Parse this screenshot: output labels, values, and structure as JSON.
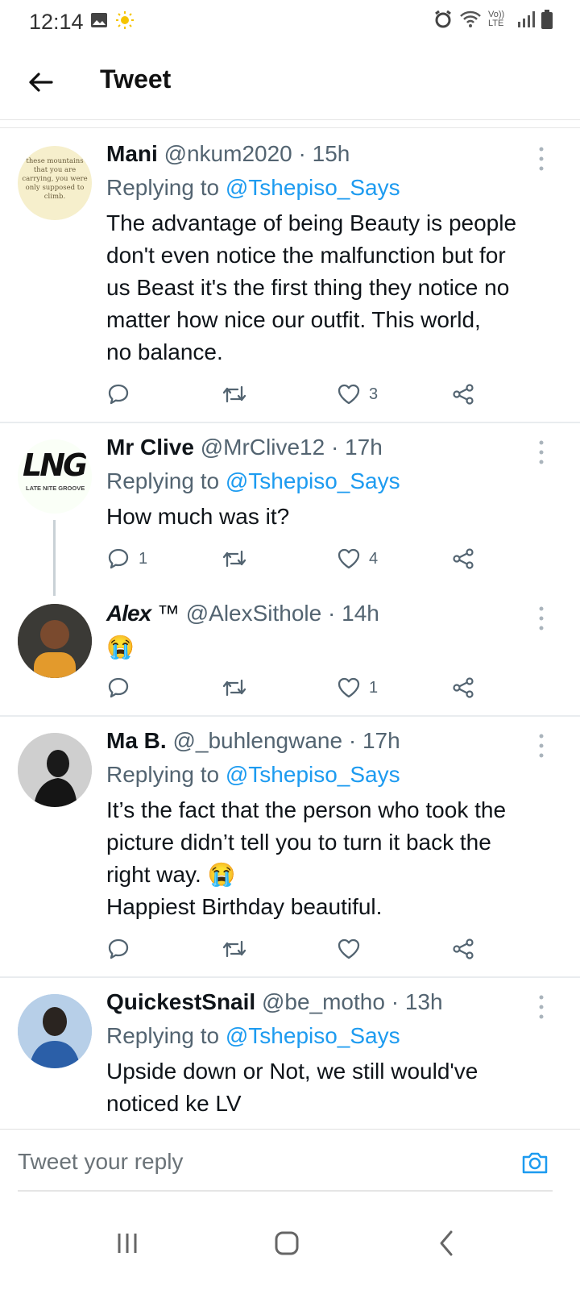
{
  "status_bar": {
    "time": "12:14",
    "network": "Vo)) LTE"
  },
  "header": {
    "title": "Tweet"
  },
  "colors": {
    "link": "#1d9bf0",
    "secondary_text": "#536471",
    "primary_text": "#0f1419"
  },
  "tweets": [
    {
      "name": "Mani",
      "handle": "@nkum2020",
      "time": "· 15h",
      "replying_prefix": "Replying to",
      "replying_handle": "@Tshepiso_Says",
      "text_lines": [
        "The advantage of being Beauty is people",
        "don't even notice the malfunction but for",
        "us Beast it's the first thing they notice no",
        "matter how nice our outfit. This world,",
        "no balance."
      ],
      "replies": "",
      "likes": "3",
      "avatar_text_lines": [
        "these mountains",
        "that you are",
        "carrying, you were",
        "only supposed to",
        "climb."
      ]
    },
    {
      "name": "Mr Clive",
      "handle": "@MrClive12",
      "time": "· 17h",
      "replying_prefix": "Replying to",
      "replying_handle": "@Tshepiso_Says",
      "text_lines": [
        "How much was it?"
      ],
      "replies": "1",
      "likes": "4",
      "avatar_logo": "LNG",
      "avatar_subtext": "LATE NITE GROOVE"
    },
    {
      "name": "Alex",
      "name_suffix": "™",
      "handle": "@AlexSithole",
      "time": "· 14h",
      "text_lines": [
        "😭"
      ],
      "replies": "",
      "likes": "1"
    },
    {
      "name": "Ma B.",
      "handle": "@_buhlengwane",
      "time": "· 17h",
      "replying_prefix": "Replying to",
      "replying_handle": "@Tshepiso_Says",
      "text_lines": [
        "It’s the fact that the person who took the",
        "picture didn’t tell you to turn it back the",
        "right way. 😭",
        "Happiest Birthday beautiful."
      ],
      "replies": "",
      "likes": ""
    },
    {
      "name": "QuickestSnail",
      "handle": "@be_motho",
      "time": "· 13h",
      "replying_prefix": "Replying to",
      "replying_handle": "@Tshepiso_Says",
      "text_lines": [
        "Upside down or Not, we still would've",
        "noticed ke LV"
      ]
    }
  ],
  "composer": {
    "placeholder": "Tweet your reply"
  },
  "icons": {
    "back": "arrow-left-icon",
    "reply": "comment-icon",
    "retweet": "retweet-icon",
    "like": "heart-icon",
    "share": "share-icon",
    "more": "more-vertical-icon",
    "camera": "camera-icon"
  }
}
